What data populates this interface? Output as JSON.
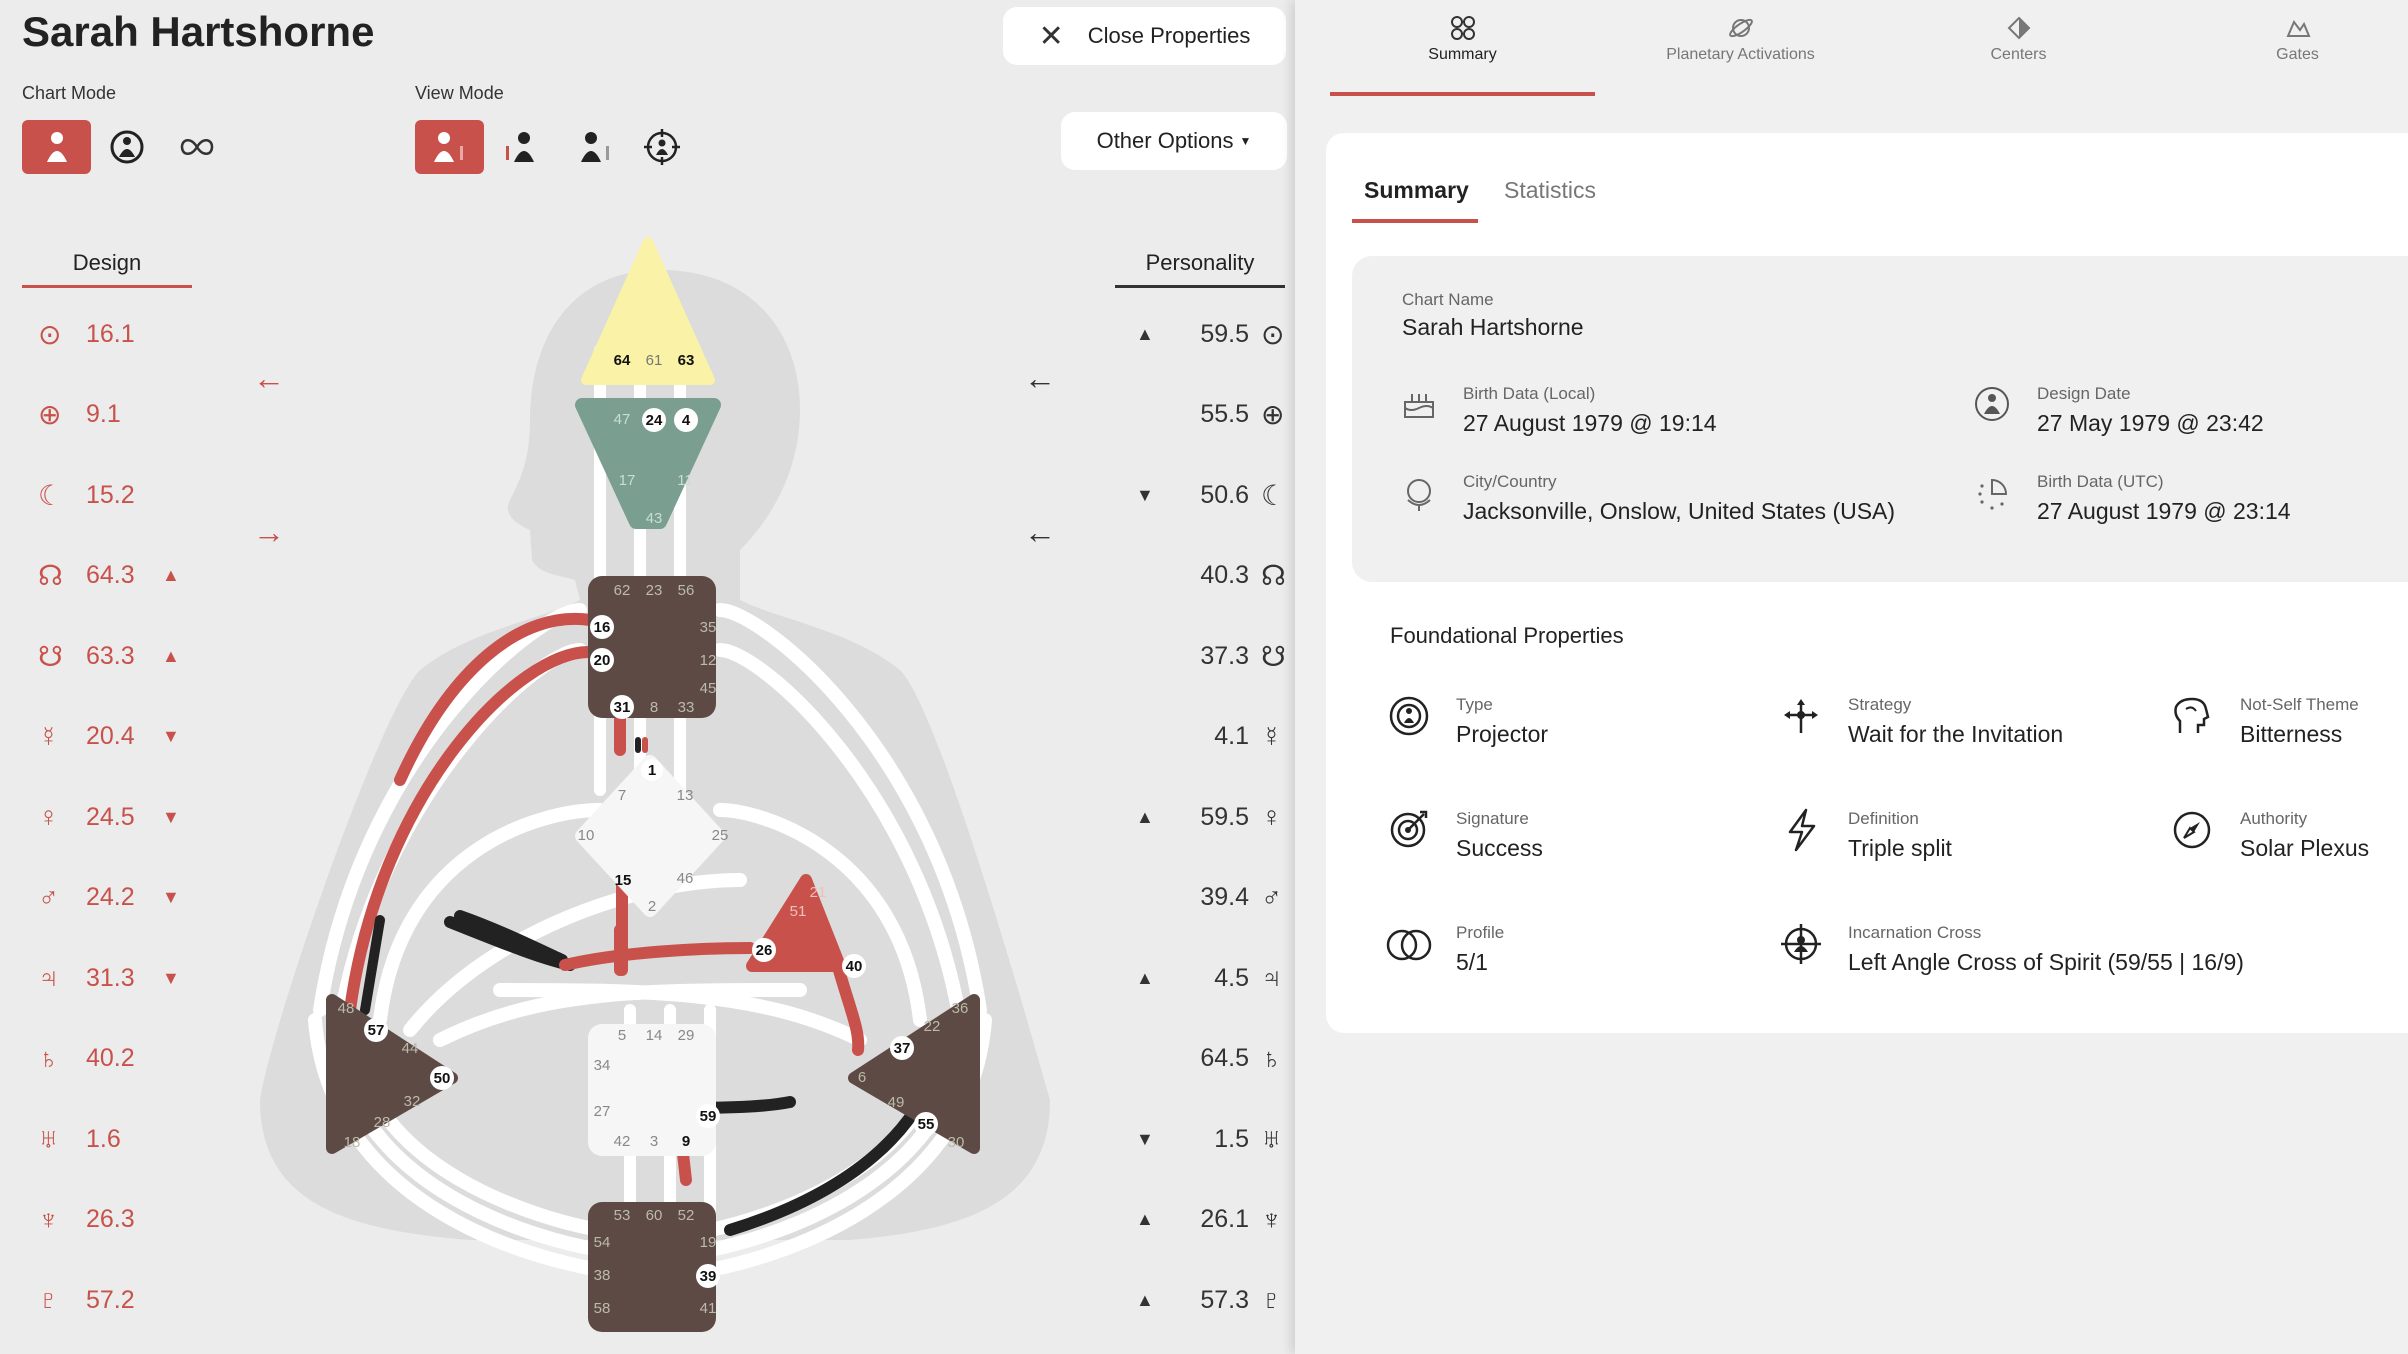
{
  "header": {
    "name": "Sarah Hartshorne",
    "chart_mode_label": "Chart Mode",
    "view_mode_label": "View Mode",
    "close_label": "Close Properties",
    "other_options_label": "Other Options"
  },
  "columns": {
    "design": "Design",
    "personality": "Personality"
  },
  "design_rows": [
    {
      "planet": "sun",
      "symbol": "⊙",
      "value": "16.1",
      "mark": ""
    },
    {
      "planet": "earth",
      "symbol": "⊕",
      "value": "9.1",
      "mark": ""
    },
    {
      "planet": "moon",
      "symbol": "☾",
      "value": "15.2",
      "mark": ""
    },
    {
      "planet": "north-node",
      "symbol": "☊",
      "value": "64.3",
      "mark": "▲"
    },
    {
      "planet": "south-node",
      "symbol": "☋",
      "value": "63.3",
      "mark": "▲"
    },
    {
      "planet": "mercury",
      "symbol": "☿",
      "value": "20.4",
      "mark": "▼"
    },
    {
      "planet": "venus",
      "symbol": "♀",
      "value": "24.5",
      "mark": "▼"
    },
    {
      "planet": "mars",
      "symbol": "♂",
      "value": "24.2",
      "mark": "▼"
    },
    {
      "planet": "jupiter",
      "symbol": "♃",
      "value": "31.3",
      "mark": "▼"
    },
    {
      "planet": "saturn",
      "symbol": "♄",
      "value": "40.2",
      "mark": ""
    },
    {
      "planet": "uranus",
      "symbol": "♅",
      "value": "1.6",
      "mark": ""
    },
    {
      "planet": "neptune",
      "symbol": "♆",
      "value": "26.3",
      "mark": ""
    },
    {
      "planet": "pluto",
      "symbol": "♇",
      "value": "57.2",
      "mark": ""
    }
  ],
  "personality_rows": [
    {
      "planet": "sun",
      "symbol": "⊙",
      "value": "59.5",
      "mark": "▲"
    },
    {
      "planet": "earth",
      "symbol": "⊕",
      "value": "55.5",
      "mark": ""
    },
    {
      "planet": "moon",
      "symbol": "☾",
      "value": "50.6",
      "mark": "▼"
    },
    {
      "planet": "north-node",
      "symbol": "☊",
      "value": "40.3",
      "mark": ""
    },
    {
      "planet": "south-node",
      "symbol": "☋",
      "value": "37.3",
      "mark": ""
    },
    {
      "planet": "mercury",
      "symbol": "☿",
      "value": "4.1",
      "mark": ""
    },
    {
      "planet": "venus",
      "symbol": "♀",
      "value": "59.5",
      "mark": "▲"
    },
    {
      "planet": "mars",
      "symbol": "♂",
      "value": "39.4",
      "mark": ""
    },
    {
      "planet": "jupiter",
      "symbol": "♃",
      "value": "4.5",
      "mark": "▲"
    },
    {
      "planet": "saturn",
      "symbol": "♄",
      "value": "64.5",
      "mark": ""
    },
    {
      "planet": "uranus",
      "symbol": "♅",
      "value": "1.5",
      "mark": "▼"
    },
    {
      "planet": "neptune",
      "symbol": "♆",
      "value": "26.1",
      "mark": "▲"
    },
    {
      "planet": "pluto",
      "symbol": "♇",
      "value": "57.3",
      "mark": "▲"
    }
  ],
  "arrows": {
    "design_top": "←",
    "design_bottom": "→",
    "personality_top": "←",
    "personality_bottom": "←"
  },
  "bodygraph": {
    "head": {
      "gates": [
        "64",
        "61",
        "63"
      ]
    },
    "ajna": {
      "gates": [
        "47",
        "24",
        "4",
        "17",
        "11",
        "43"
      ]
    },
    "throat": {
      "gates": [
        "62",
        "23",
        "56",
        "16",
        "35",
        "20",
        "12",
        "45",
        "31",
        "8",
        "33"
      ]
    },
    "g": {
      "gates": [
        "1",
        "7",
        "13",
        "10",
        "25",
        "15",
        "46",
        "2"
      ]
    },
    "heart": {
      "gates": [
        "21",
        "51",
        "26",
        "40"
      ]
    },
    "spleen": {
      "gates": [
        "48",
        "57",
        "44",
        "50",
        "32",
        "28",
        "18"
      ]
    },
    "sacral": {
      "gates": [
        "5",
        "14",
        "29",
        "34",
        "27",
        "59",
        "42",
        "3",
        "9"
      ]
    },
    "solar_plexus": {
      "gates": [
        "36",
        "22",
        "37",
        "6",
        "49",
        "55",
        "30"
      ]
    },
    "root": {
      "gates": [
        "53",
        "60",
        "52",
        "54",
        "19",
        "38",
        "39",
        "58",
        "41"
      ]
    }
  },
  "tabs": [
    {
      "label": "Summary",
      "icon": "summary-icon"
    },
    {
      "label": "Planetary Activations",
      "icon": "planet-icon"
    },
    {
      "label": "Centers",
      "icon": "centers-icon"
    },
    {
      "label": "Gates",
      "icon": "gates-icon"
    }
  ],
  "subtabs": {
    "summary": "Summary",
    "statistics": "Statistics"
  },
  "info": {
    "chart_name_label": "Chart Name",
    "chart_name": "Sarah Hartshorne",
    "birth_local_label": "Birth Data (Local)",
    "birth_local": "27 August 1979 @ 19:14",
    "design_date_label": "Design Date",
    "design_date": "27 May 1979 @ 23:42",
    "city_label": "City/Country",
    "city": "Jacksonville, Onslow, United States (USA)",
    "birth_utc_label": "Birth Data (UTC)",
    "birth_utc": "27 August 1979 @ 23:14"
  },
  "foundational": {
    "title": "Foundational Properties",
    "type_label": "Type",
    "type": "Projector",
    "strategy_label": "Strategy",
    "strategy": "Wait for the Invitation",
    "notself_label": "Not-Self Theme",
    "notself": "Bitterness",
    "signature_label": "Signature",
    "signature": "Success",
    "definition_label": "Definition",
    "definition": "Triple split",
    "authority_label": "Authority",
    "authority": "Solar Plexus",
    "profile_label": "Profile",
    "profile": "5/1",
    "cross_label": "Incarnation Cross",
    "cross": "Left Angle Cross of Spirit (59/55 | 16/9)"
  },
  "colors": {
    "accent": "#c8524b",
    "dark_center": "#5e4a45",
    "head": "#faf2a6",
    "ajna": "#7a9f90",
    "heart": "#c8524b"
  }
}
